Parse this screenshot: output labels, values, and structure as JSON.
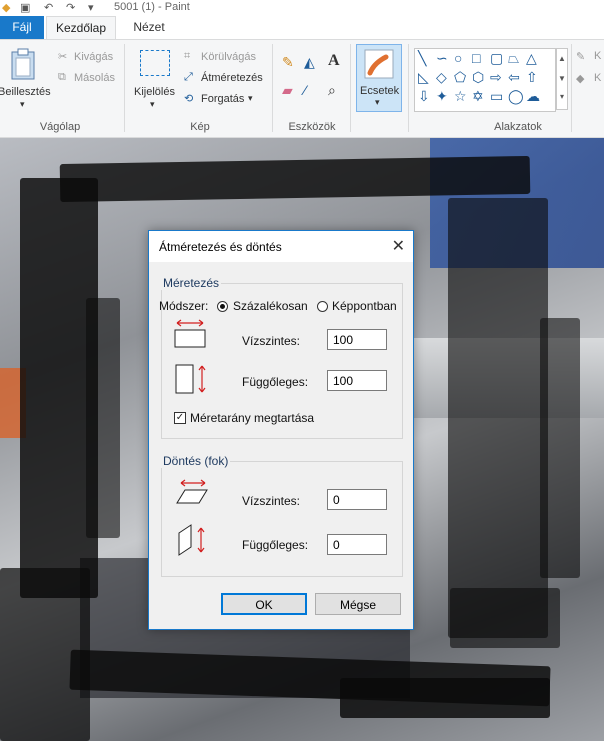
{
  "window": {
    "title": "5001 (1) - Paint"
  },
  "tabs": {
    "file": "Fájl",
    "home": "Kezdőlap",
    "view": "Nézet"
  },
  "ribbon": {
    "clipboard": {
      "paste": "Beillesztés",
      "cut": "Kivágás",
      "copy": "Másolás",
      "label": "Vágólap"
    },
    "image": {
      "select": "Kijelölés",
      "crop": "Körülvágás",
      "resize": "Átméretezés",
      "rotate": "Forgatás",
      "label": "Kép"
    },
    "tools": {
      "label": "Eszközök"
    },
    "brushes": {
      "label": "Ecsetek"
    },
    "shapes": {
      "label": "Alakzatok"
    },
    "partial_right": {
      "label1": "K",
      "label2": "K"
    }
  },
  "dialog": {
    "title": "Átméretezés és döntés",
    "resize_section": "Méretezés",
    "method_label": "Módszer:",
    "method_percent": "Százalékosan",
    "method_pixels": "Képpontban",
    "horizontal_label": "Vízszintes:",
    "horizontal_value": "100",
    "vertical_label": "Függőleges:",
    "vertical_value": "100",
    "keep_ratio": "Méretarány megtartása",
    "skew_section": "Döntés (fok)",
    "skew_horizontal_label": "Vízszintes:",
    "skew_horizontal_value": "0",
    "skew_vertical_label": "Függőleges:",
    "skew_vertical_value": "0",
    "ok": "OK",
    "cancel": "Mégse"
  },
  "colors": {
    "accent": "#1979ca",
    "arrow_red": "#d21f1f"
  }
}
